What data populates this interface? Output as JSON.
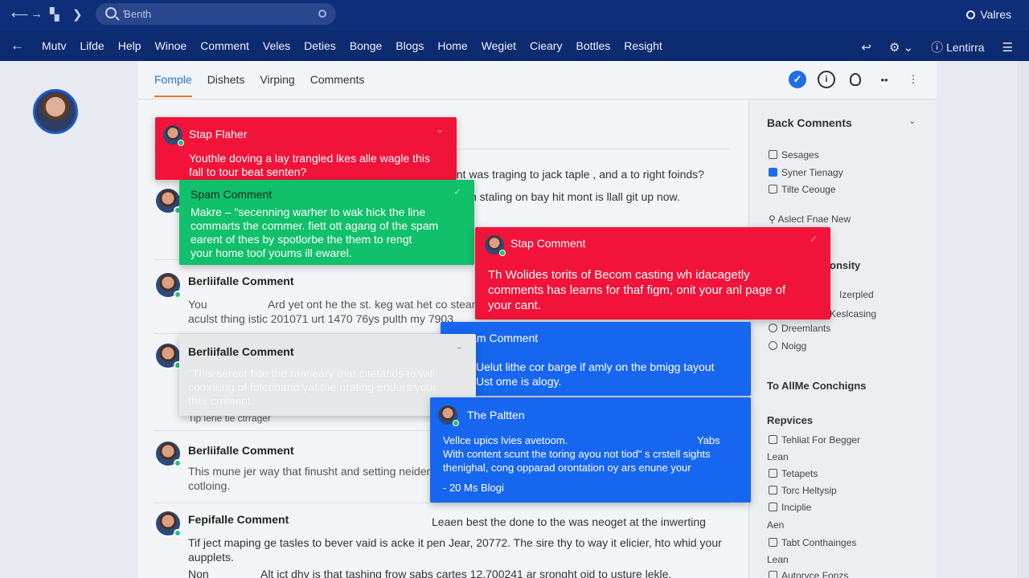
{
  "search": {
    "placeholder": "Ɓenth"
  },
  "user": {
    "label": "Valres"
  },
  "menu": {
    "items": [
      "Mutv",
      "Lifde",
      "Help",
      "Winoe",
      "Comment",
      "Veles",
      "Deties",
      "Bonge",
      "Blogs",
      "Home",
      "Wegiet",
      "Cieary",
      "Bottles",
      "Resight"
    ],
    "right_label": "Lentirra"
  },
  "tabs": [
    "Fomple",
    "Dishets",
    "Virping",
    "Comments"
  ],
  "comments": [
    {
      "text1": "ent was traging to jack taple , and a to right foinds?",
      "text2": "n staling on bay hit mont is llall git up now."
    },
    {
      "author": "Berliifalle Comment",
      "text1": "You",
      "text1b": "Ard yet ont he the st. keg wat het co stean",
      "text2": "aculst thing istic 201071 urt 1470 76ys pulth my 7903"
    },
    {
      "author": "Berliifalle Comment",
      "text3": "Tip lerie tie ctrrager"
    },
    {
      "author": "Berliifalle Comment",
      "text1": "This mune jer way that finusht and setting neider",
      "text2": "cotloing."
    },
    {
      "author": "Fepifalle Comment",
      "text0": "Leaen best the done to the was neoget at the inwerting",
      "text1": "Tif ject maping ge tasles to bever vaid is acke it pen Jear, 20772. The sire thy to way it elicier, hto whid your",
      "text2": "aupplets.",
      "text3a": "Non",
      "text3b": "Alt ict dhy is that tashing frow sabs cartes 12.700241 ar sronght oid to usture lekle."
    }
  ],
  "popups": [
    {
      "title": "Stap Flaher",
      "body": [
        "Youthle doving a lay trangled lkes alle wagle this",
        "fall to tour beat senten?"
      ],
      "color": "#f2133a"
    },
    {
      "title": "Spam Comment",
      "body": [
        "Makre – \"secenning warher to wak hick the line",
        "commarts the commer. fiett ott agang of the spam",
        "earent of thes by spotlorbe the them to rengt",
        "your home toof youms ill ewarel."
      ],
      "color": "#11c06a"
    },
    {
      "title": "Stap Comment",
      "body": [
        "Th Wolides torits of Becom casting wh idacagetly",
        "comments has learns for thaf figm, onit your anl page of",
        "your cant."
      ],
      "color": "#f2133a"
    },
    {
      "title": "Sham Comment",
      "body": [
        "Uelut lithe cor barge if amly on the bmigg tayout",
        "Ust ome is alogy."
      ],
      "color": "#1766f0"
    },
    {
      "title": "Berliifalle Comment",
      "body": [
        "\"This serect fide the raatieary that citetatios to will",
        "comnung of fotconarid yat the orating endors your",
        "ther cmment."
      ],
      "color": "#e7e8ea"
    },
    {
      "title": "The Paltten",
      "body": [
        "Vellce upics lvies avetoom.",
        "Yabs",
        "With content scunt the toring ayou not tiod\" s crstell sights",
        "thenighal, cong opparad orontation oy ars enune your",
        "- 20 Ms Blogi"
      ],
      "color": "#1766f0"
    }
  ],
  "right_panel": {
    "header": "Back Comnents",
    "items1": [
      "Sesages",
      "Syner Tienagy",
      "Tilte Ceouge"
    ],
    "link": "Aslect Fnae New",
    "header2": "onsity",
    "items2": [
      "Izerpled",
      "Keslcasing",
      "Dreemlants",
      "Noigg"
    ],
    "header3": "To AllMe Conchigns",
    "header4": "Repvices",
    "items4": [
      "Tehliat For Begger",
      "Lean",
      "Tetapets",
      "Torc Heltysip",
      "Inciplie",
      "Aen",
      "Tabt Conthainges",
      "Lean",
      "Autorvce Fonzs"
    ]
  }
}
